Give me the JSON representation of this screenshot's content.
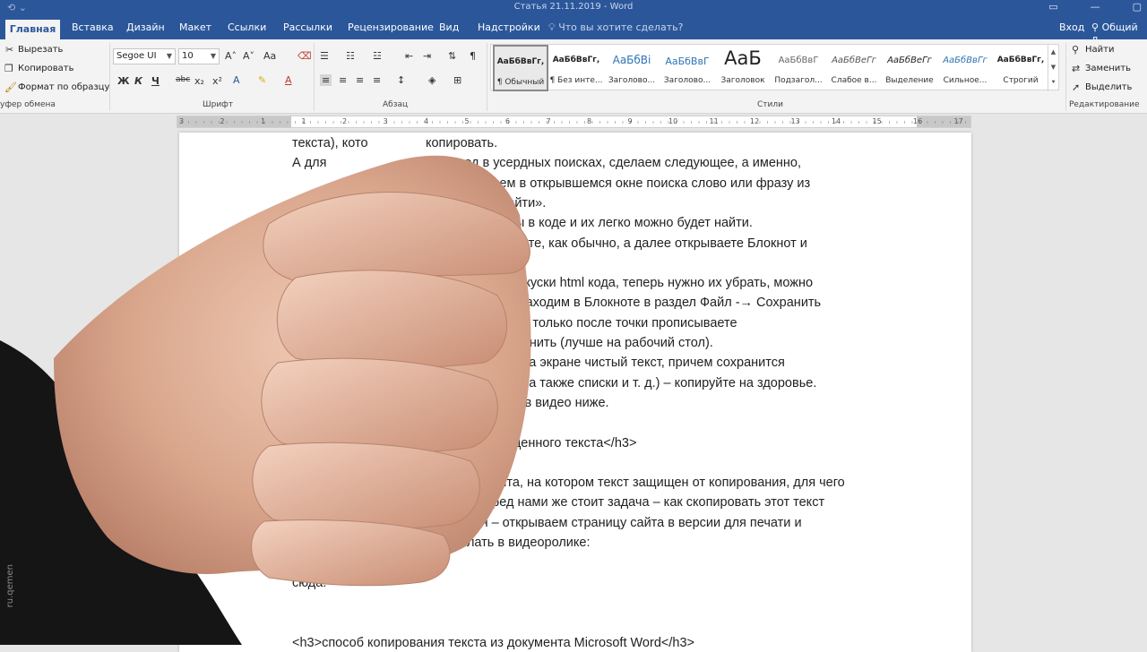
{
  "window": {
    "title": "Статья 21.11.2019 - Word",
    "account_label": "Вход",
    "share_label": "Общий д"
  },
  "tabs": [
    {
      "label": "Главная"
    },
    {
      "label": "Вставка"
    },
    {
      "label": "Дизайн"
    },
    {
      "label": "Макет"
    },
    {
      "label": "Ссылки"
    },
    {
      "label": "Рассылки"
    },
    {
      "label": "Рецензирование"
    },
    {
      "label": "Вид"
    },
    {
      "label": "Надстройки"
    }
  ],
  "tell_me": {
    "placeholder": "Что вы хотите сделать?"
  },
  "clipboard": {
    "cut": "Вырезать",
    "copy": "Копировать",
    "format_painter": "Формат по образцу",
    "group_label": "уфер обмена"
  },
  "font": {
    "name": "Segoe UI",
    "size": "10",
    "group_label": "Шрифт",
    "bold": "Ж",
    "italic": "К",
    "underline": "Ч",
    "strike": "abc",
    "subscript": "x₂",
    "superscript": "x²",
    "case": "Aa"
  },
  "paragraph": {
    "group_label": "Абзац"
  },
  "styles": {
    "group_label": "Стили",
    "items": [
      {
        "preview": "АаБбВвГг,",
        "name": "¶ Обычный"
      },
      {
        "preview": "АаБбВвГг,",
        "name": "¶ Без инте..."
      },
      {
        "preview": "АаБбВі",
        "name": "Заголово..."
      },
      {
        "preview": "АаБбВвГ",
        "name": "Заголово..."
      },
      {
        "preview": "АаБ",
        "name": "Заголовок"
      },
      {
        "preview": "АаБбВвГ",
        "name": "Подзагол..."
      },
      {
        "preview": "АаБбВеГг",
        "name": "Слабое в..."
      },
      {
        "preview": "АаБбВеГг",
        "name": "Выделение"
      },
      {
        "preview": "АаБбВвГг",
        "name": "Сильное..."
      },
      {
        "preview": "АаБбВвГг,",
        "name": "Строгий"
      }
    ]
  },
  "editing": {
    "find": "Найти",
    "replace": "Заменить",
    "select": "Выделить",
    "group_label": "Редактирование"
  },
  "ruler": {
    "numbers": [
      "3",
      "2",
      "1",
      "1",
      "2",
      "3",
      "4",
      "5",
      "6",
      "7",
      "8",
      "9",
      "10",
      "11",
      "12",
      "13",
      "14",
      "15",
      "16",
      "17"
    ]
  },
  "document": {
    "lines": [
      {
        "text": "текста), кото                копировать."
      },
      {
        "text": "А для                         » весь код в усердных поисках, сделаем следующее, а именно,"
      },
      {
        "text": "                                trl+F и вписываем в открывшемся окне поиска слово или фразу из"
      },
      {
        "text": "                                      ли кнопку «Найти»."
      },
      {
        "text": "                                     будут выделены в коде и их легко можно будет найти."
      },
      {
        "text": "                                         ется и копируете, как обычно, а далее открываете Блокнот и"
      },
      {
        "text": ""
      },
      {
        "text": "                                       скопировали и куски html кода, теперь нужно их убрать, можно"
      },
      {
        "text": "                                       можно и так – заходим в Блокноте в раздел Файл -→ Сохранить"
      },
      {
        "text": "                                        как вам угодно, только после точки прописываете"
      },
      {
        "text": "                                       ажимаем Сохранить (лучше на рабочий стол)."
      },
      {
        "text": "                                      зером и видим на экране чистый текст, причем сохранится"
      },
      {
        "text": "                                     рным, курсивом, а также списки и т. д.) – копируйте на здоровье."
      },
      {
        "text": "                                     ели посмотрите в видео ниже."
      },
      {
        "text": ""
      },
      {
        "text": "                                     рования защищенного текста</h3>"
      },
      {
        "text": ""
      },
      {
        "text": "                                      ого-либо сайта, на котором текст защищен от копирования, для чего"
      },
      {
        "text": "                                      автора, перед нами же стоит задача – как скопировать этот текст"
      },
      {
        "text": "                                      я кажется – открываем страницу сайта в версии для печати и"
      },
      {
        "text": "                                      то сделать в видеоролике:"
      },
      {
        "text": ""
      },
      {
        "text": "сюда:"
      },
      {
        "text": ""
      },
      {
        "text": ""
      },
      {
        "text": "<h3>способ копирования текста из документа Microsoft Word</h3>"
      }
    ]
  },
  "watermark": "ru.qemen"
}
